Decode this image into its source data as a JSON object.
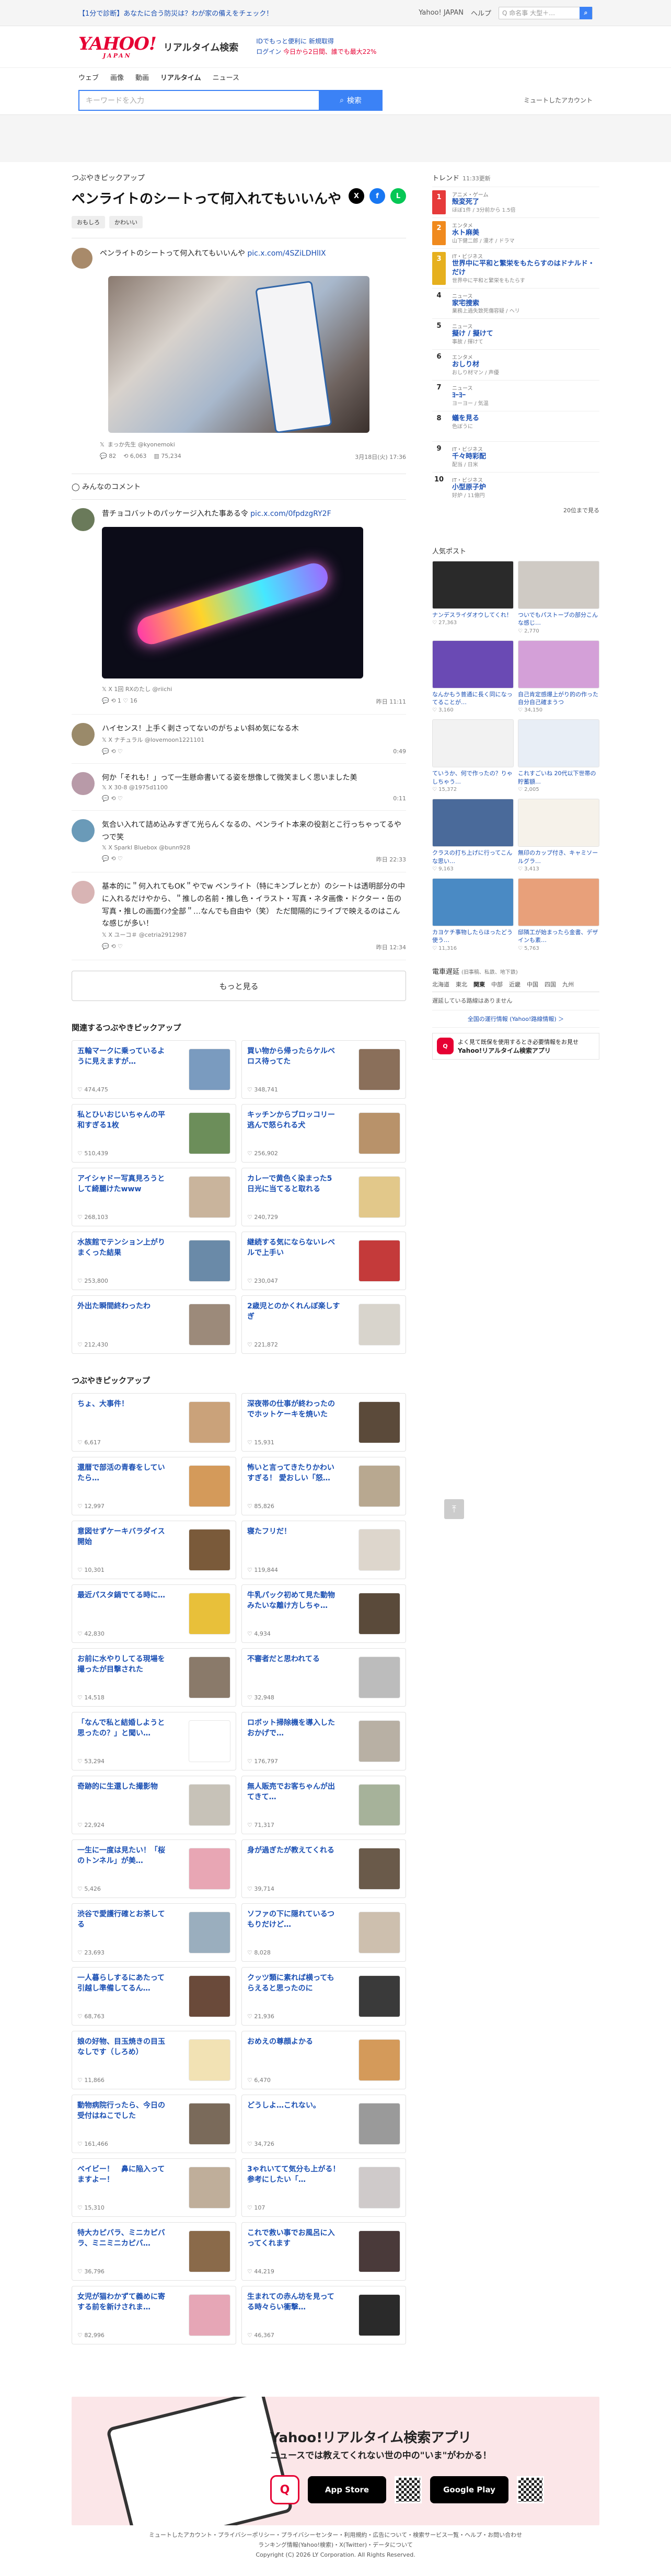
{
  "topbar": {
    "promo": "【1分で診断】あなたに合う防災は？わが家の備えをチェック！",
    "links": [
      "Yahoo! JAPAN",
      "ヘルプ"
    ],
    "search_placeholder": "ウェブ検索",
    "search_right": "Q 命名事 大型＋…"
  },
  "brand": {
    "logo": "YAHOO!",
    "logo_sub": "JAPAN",
    "title": "リアルタイム検索",
    "notice_line1": "IDでもっと便利に 新規取得",
    "notice_line2_prefix": "ログイン",
    "notice_line2_rest": "今日から2日間、誰でも最大22%"
  },
  "tabs": [
    "ウェブ",
    "画像",
    "動画",
    "リアルタイム",
    "ニュース"
  ],
  "search": {
    "placeholder": "キーワードを入力",
    "button": "検索",
    "login": "ミュートしたアカウント"
  },
  "pickup": {
    "section_label": "つぶやきピックアップ",
    "title": "ペンライトのシートって何入れてもいいんや",
    "tags": [
      "おもしろ",
      "かわいい"
    ],
    "share": [
      "X",
      "f",
      "L"
    ],
    "top": {
      "text": "ペンライトのシートって何入れてもいいんや",
      "link": "pic.x.com/4SZiLDHlIX",
      "user": "まっか先生 @kyonemoki",
      "likes": "82",
      "retweets": "6,063",
      "views": "75,234",
      "time": "3月18日(火) 17:36"
    },
    "comments_label": "みんなのコメント",
    "comments": [
      {
        "text": "昔チョコバットのパッケージ入れた事ある令",
        "link": "pic.x.com/0fpdzgRY2F",
        "user": "X 1回 RXのたし @riichi",
        "time": "昨日 11:11",
        "r": "1",
        "l": "16",
        "img": true
      },
      {
        "text": "ハイセンス！上手く剥さってないのがちょい斜め気になる木",
        "link": "",
        "user": "X ナチュラル @lovemoon1221101",
        "time": "0:49",
        "r": "",
        "l": "",
        "img": false
      },
      {
        "text": "何か「それも！」って一生懸命書いてる姿を想像して微笑ましく思いました美",
        "link": "",
        "user": "X 30-8 @1975d1100",
        "time": "0:11",
        "r": "",
        "l": "",
        "img": false
      },
      {
        "text": "気合い入れて詰め込みすぎて光らんくなるの、ペンライト本来の役割とこ行っちゃってるやつで笑",
        "link": "",
        "user": "X Sparkl Bluebox @bunn928",
        "time": "昨日 22:33",
        "r": "",
        "l": "",
        "img": false
      },
      {
        "text": "基本的に＂何入れてもOK＂やでw ペンライト（特にキンブレとか）のシートは透明部分の中に入れるだけやから、＂推しの名前・推し色・イラスト・写真・ネタ画像・ドクター・缶の写真・推しの画面ｲﾝｸ全部＂…なんでも自由や（笑） ただ間隔的にライブで映えるのはこんな感じが多い！",
        "link": "",
        "user": "X ユーコ＃ @cetria2912987",
        "time": "昨日 12:34",
        "r": "",
        "l": "",
        "img": false
      }
    ],
    "more": "もっと見る"
  },
  "related": {
    "title": "関連するつぶやきピックアップ",
    "items": [
      {
        "t": "五輪マークに乗っているように見えますが…",
        "v": "474,475",
        "c": "#7a9bbf"
      },
      {
        "t": "買い物から帰ったらケルベロス待ってた",
        "v": "348,741",
        "c": "#8a6f5a"
      },
      {
        "t": "私とひいおじいちゃんの平和すぎる1枚",
        "v": "510,439",
        "c": "#6c8e5a"
      },
      {
        "t": "キッチンからブロッコリー逃んで怒られる犬",
        "v": "256,902",
        "c": "#b8926a"
      },
      {
        "t": "アイシャドー写真見ろうとして綺麗けたwww",
        "v": "268,103",
        "c": "#c9b49c"
      },
      {
        "t": "カレーで黄色く染まった5 日光に当てると取れる",
        "v": "240,729",
        "c": "#e2c88a"
      },
      {
        "t": "水族館でテンション上がりまくった結果",
        "v": "253,800",
        "c": "#6a8aa8"
      },
      {
        "t": "継続する気にならないレベルで上手い",
        "v": "230,047",
        "c": "#c43a3a"
      },
      {
        "t": "外出た瞬間終わったわ",
        "v": "212,430",
        "c": "#9c8a7a"
      },
      {
        "t": "2歳児とのかくれんぼ楽しすぎ",
        "v": "221,872",
        "c": "#d8d4cc"
      }
    ]
  },
  "others": {
    "title": "つぶやきピックアップ",
    "items": [
      {
        "t": "ちょ、大事件！",
        "v": "6,617",
        "c": "#caa27a"
      },
      {
        "t": "深夜帯の仕事が終わったのでホットケーキを焼いた",
        "v": "15,931",
        "c": "#5b4a3a"
      },
      {
        "t": "還暦で部活の青春をしていたら…",
        "v": "12,997",
        "c": "#d49a5a"
      },
      {
        "t": "怖いと言ってきたりかわいすぎる！ 愛おしい「怒…",
        "v": "85,826",
        "c": "#b8a890"
      },
      {
        "t": "意図せずケーキバラダイス開始",
        "v": "10,301",
        "c": "#7a5a3a"
      },
      {
        "t": "寝たフリだ！",
        "v": "119,844",
        "c": "#ddd6cc"
      },
      {
        "t": "最近パスタ鍋でてる時に…",
        "v": "42,830",
        "c": "#e8c03a"
      },
      {
        "t": "牛乳パック初めて見た動物みたいな離け方しちゃ…",
        "v": "4,934",
        "c": "#5a4a3a"
      },
      {
        "t": "お前に水やりしてる現場を撮ったが目撃された",
        "v": "14,518",
        "c": "#8a7a6a"
      },
      {
        "t": "不審者だと思われてる",
        "v": "32,948",
        "c": "#bcbcbc"
      },
      {
        "t": "「なんで私と結婚しようと思ったの？」と聞い…",
        "v": "53,294",
        "c": "#ffffff"
      },
      {
        "t": "ロボット掃除機を導入したおかげで…",
        "v": "176,797",
        "c": "#b8b0a4"
      },
      {
        "t": "奇跡的に生還した撮影物",
        "v": "22,924",
        "c": "#c7c2b8"
      },
      {
        "t": "無人販売でお客ちゃんが出てきて…",
        "v": "71,317",
        "c": "#a6b29a"
      },
      {
        "t": "一生に一度は見たい！「桜のトンネル」が美…",
        "v": "5,426",
        "c": "#e8a6b4"
      },
      {
        "t": "身が過ぎたが教えてくれる",
        "v": "39,714",
        "c": "#6a5a4a"
      },
      {
        "t": "渋谷で愛護行確とお茶してる",
        "v": "23,693",
        "c": "#9aaebe"
      },
      {
        "t": "ソファの下に隠れているつもりだけど…",
        "v": "8,028",
        "c": "#cdbfae"
      },
      {
        "t": "一人暮らしするにあたって引越し準備してるん…",
        "v": "68,763",
        "c": "#6a4a3a"
      },
      {
        "t": "クッツ類に素れば横ってもらえると思ったのに",
        "v": "21,936",
        "c": "#3a3a3a"
      },
      {
        "t": "娘の好物、目玉焼きの目玉なしです（しろめ）",
        "v": "11,866",
        "c": "#f2e2b4"
      },
      {
        "t": "おめえの尊顔よかる",
        "v": "6,470",
        "c": "#d49a5a"
      },
      {
        "t": "動物病院行ったら、今日の受付はねこでした",
        "v": "161,466",
        "c": "#7a6a5a"
      },
      {
        "t": "どうしよ…これない。",
        "v": "34,726",
        "c": "#9a9a9a"
      },
      {
        "t": "ベイビー！　鼻に陥入ってますよー！",
        "v": "15,310",
        "c": "#bfae9a"
      },
      {
        "t": "3ゃれいてて気分も上がる！　参考にしたい「…",
        "v": "107",
        "c": "#cfcaca"
      },
      {
        "t": "特大カピバラ、ミニカピバラ、ミニミニカピバ…",
        "v": "36,796",
        "c": "#8a6a4a"
      },
      {
        "t": "これで救い事でお風呂に入ってくれます",
        "v": "44,219",
        "c": "#4a3a3a"
      },
      {
        "t": "女児が猫わかずて義めに寄する前を新けされま…",
        "v": "82,996",
        "c": "#e6a6b6"
      },
      {
        "t": "生まれての赤ん坊を見ってる時々らい衝撃…",
        "v": "46,367",
        "c": "#2a2a2a"
      }
    ]
  },
  "trend": {
    "title": "トレンド",
    "time": "11:33更新",
    "items": [
      {
        "r": "1",
        "cat": "アニメ・ゲーム",
        "nm": "殻変死了",
        "sub": "ほぼ1件 / 3分前から 1.5倍",
        "cls": "top"
      },
      {
        "r": "2",
        "cat": "エンタメ",
        "nm": "水ト麻美",
        "sub": "山下健二郎 / 漫才 / ドラマ",
        "cls": "top o"
      },
      {
        "r": "3",
        "cat": "IT・ビジネス",
        "nm": "世界中に平和と繁栄をもたらすのはドナルド・だけ",
        "sub": "世界中に平和と繁栄をもたらす",
        "cls": "top y"
      },
      {
        "r": "4",
        "cat": "ニュース",
        "nm": "家宅捜索",
        "sub": "業務上過失致死傷容疑 / ヘリ",
        "cls": ""
      },
      {
        "r": "5",
        "cat": "ニュース",
        "nm": "擬け / 擬けて",
        "sub": "事故 / 揮けて",
        "cls": ""
      },
      {
        "r": "6",
        "cat": "エンタメ",
        "nm": "おしり材",
        "sub": "おしり材マン / 声優",
        "cls": ""
      },
      {
        "r": "7",
        "cat": "ニュース",
        "nm": "ﾖｰﾖｰ",
        "sub": "ヨーヨー / 気温",
        "cls": ""
      },
      {
        "r": "8",
        "cat": "",
        "nm": "蟻を見る",
        "sub": "色ぼうに",
        "cls": ""
      },
      {
        "r": "9",
        "cat": "IT・ビジネス",
        "nm": "千々時彩配",
        "sub": "配当 / 日米",
        "cls": ""
      },
      {
        "r": "10",
        "cat": "IT・ビジネス",
        "nm": "小型原子炉",
        "sub": "好炉 / 11億円",
        "cls": ""
      }
    ],
    "more": "20位まで見る"
  },
  "popular": {
    "title": "人気ポスト",
    "items": [
      {
        "t": "ナンデスライダオウしてくれ！",
        "v": "27,363",
        "c": "#2a2a2a"
      },
      {
        "t": "ついでもパストーブの部分こんな感じ…",
        "v": "2,770",
        "c": "#cfcac4"
      },
      {
        "t": "なんかもう普通に長く同になってることが…",
        "v": "3,160",
        "c": "#6a4ab4"
      },
      {
        "t": "自己肯定感爆上がり的の作った自分自己確まうつ",
        "v": "34,150",
        "c": "#d4a0d8"
      },
      {
        "t": "ていうか、何で作ったの？りゃしちゃう…",
        "v": "15,372",
        "c": "#f2f2f2"
      },
      {
        "t": "これすごいね 20代以下世帯の貯蓄額…",
        "v": "2,005",
        "c": "#e8eef6"
      },
      {
        "t": "クラスの打ち上げに行ってこんな思い…",
        "v": "9,163",
        "c": "#4a6a9a"
      },
      {
        "t": "無印のカップ付き、キャミソールグラ…",
        "v": "3,413",
        "c": "#f6f2ea"
      },
      {
        "t": "カヨケチ事物したらほったどう使う…",
        "v": "11,316",
        "c": "#4a8ac4"
      },
      {
        "t": "邸隣工が始まったら金書、デザインも素…",
        "v": "5,763",
        "c": "#e8a07a"
      }
    ]
  },
  "quake": {
    "title": "電車遅延",
    "sub": "(旧事稿、私鉄、地下鉄)",
    "tabs": [
      "北海道",
      "東北",
      "関東",
      "中部",
      "近畿",
      "中国",
      "四国",
      "九州"
    ],
    "active": "関東",
    "none": "遅延している路線はありません",
    "link": "全国の運行情報 (Yahoo!路線情報) ＞"
  },
  "app": {
    "line1": "よく見て既保を使用するとき必要情報をお見せ",
    "name": "Yahoo!リアルタイム検索アプリ"
  },
  "banner": {
    "title": "Yahoo!リアルタイム検索アプリ",
    "sub": "ニュースでは教えてくれない世の中の\"いま\"がわかる！",
    "appstore": "App Store",
    "googleplay": "Google Play"
  },
  "footer": {
    "line1": "ミュートしたアカウント・プライバシーポリシー・プライバシーセンター・利用規約・広告について・検索サービス一覧・ヘルプ・お問い合わせ",
    "line2": "ランキング情報(Yahoo!検索)・X(Twitter)・データについて",
    "copy": "Copyright (C) 2026 LY Corporation. All Rights Reserved."
  }
}
